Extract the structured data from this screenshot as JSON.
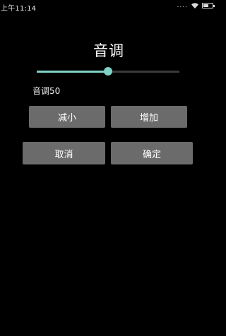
{
  "status_bar": {
    "time": "上午11:14",
    "signal_dots": "....",
    "battery_level": 0.6
  },
  "dialog": {
    "title": "音调",
    "slider": {
      "value": 50,
      "max": 100,
      "accent_color": "#7fd2c6",
      "track_color": "#3a3a3a"
    },
    "value_text": "音调50",
    "buttons": {
      "decrease": "减小",
      "increase": "增加",
      "cancel": "取消",
      "confirm": "确定"
    },
    "button_color": "#6b6b6b"
  },
  "icons": {
    "wifi": "wifi-icon",
    "battery": "battery-icon",
    "signal": "signal-icon"
  }
}
